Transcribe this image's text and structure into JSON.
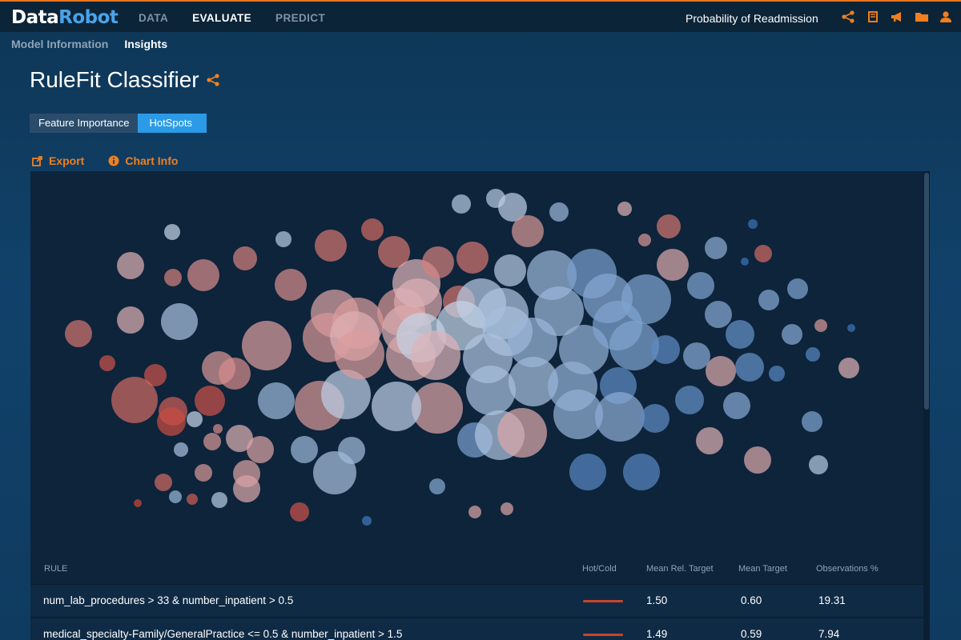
{
  "brand": {
    "part1": "Data",
    "part2": "Robot"
  },
  "nav": [
    {
      "label": "DATA"
    },
    {
      "label": "EVALUATE"
    },
    {
      "label": "PREDICT"
    }
  ],
  "nav_active": "EVALUATE",
  "project_title": "Probability of Readmission",
  "top_icons": [
    "share-icon",
    "book-icon",
    "megaphone-icon",
    "folder-icon",
    "user-icon"
  ],
  "subnav": [
    {
      "label": "Model Information"
    },
    {
      "label": "Insights"
    }
  ],
  "subnav_active": "Insights",
  "page_title": "RuleFit Classifier",
  "tabs": [
    {
      "label": "Feature Importance"
    },
    {
      "label": "HotSpots"
    }
  ],
  "tabs_active": "HotSpots",
  "actions": {
    "export": "Export",
    "chart_info": "Chart Info"
  },
  "colors": {
    "accent": "#f07f1f",
    "hot": "#c9452b",
    "cold": "#2b6fb3",
    "active_tab": "#2b9be8"
  },
  "chart_data": {
    "type": "bubble",
    "description_scale": "color from hot (red) to cold (blue)"
  },
  "table": {
    "columns": [
      "RULE",
      "Hot/Cold",
      "Mean Rel. Target",
      "Mean Target",
      "Observations %"
    ],
    "rows": [
      {
        "rule": "num_lab_procedures > 33 & number_inpatient > 0.5",
        "hot_cold": "hot",
        "mean_rel_target": "1.50",
        "mean_target": "0.60",
        "observations": "19.31"
      },
      {
        "rule": "medical_specialty-Family/GeneralPractice <= 0.5 & number_inpatient > 1.5",
        "hot_cold": "hot",
        "mean_rel_target": "1.49",
        "mean_target": "0.59",
        "observations": "7.94"
      }
    ]
  }
}
